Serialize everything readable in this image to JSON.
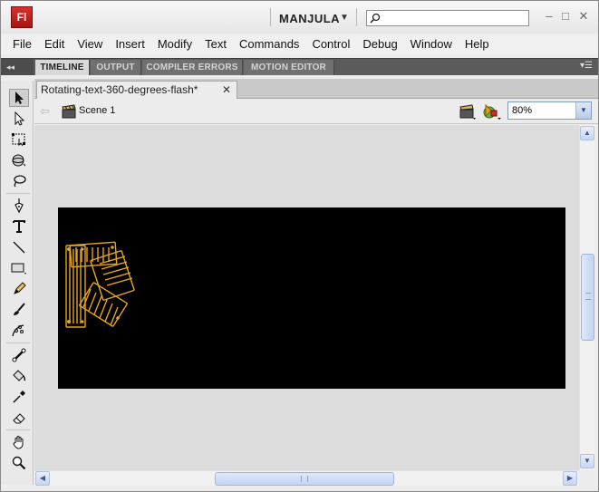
{
  "app": {
    "logo": "Fl",
    "workspace": "MANJULA",
    "search_placeholder": ""
  },
  "menu": [
    "File",
    "Edit",
    "View",
    "Insert",
    "Modify",
    "Text",
    "Commands",
    "Control",
    "Debug",
    "Window",
    "Help"
  ],
  "panel_tabs": [
    "TIMELINE",
    "OUTPUT",
    "COMPILER ERRORS",
    "MOTION EDITOR"
  ],
  "document": {
    "tab_title": "Rotating-text-360-degrees-flash*",
    "scene": "Scene 1",
    "zoom": "80%"
  },
  "tools": [
    "selection-tool",
    "subselection-tool",
    "free-transform-tool",
    "3d-rotation-tool",
    "lasso-tool",
    "pen-tool",
    "text-tool",
    "line-tool",
    "rectangle-tool",
    "pencil-tool",
    "brush-tool",
    "deco-tool",
    "bone-tool",
    "paint-bucket-tool",
    "eyedropper-tool",
    "eraser-tool",
    "hand-tool",
    "zoom-tool"
  ],
  "colors": {
    "stage": "#000000",
    "artwork": "#e8a51a",
    "fl_logo": "#c0201a"
  }
}
